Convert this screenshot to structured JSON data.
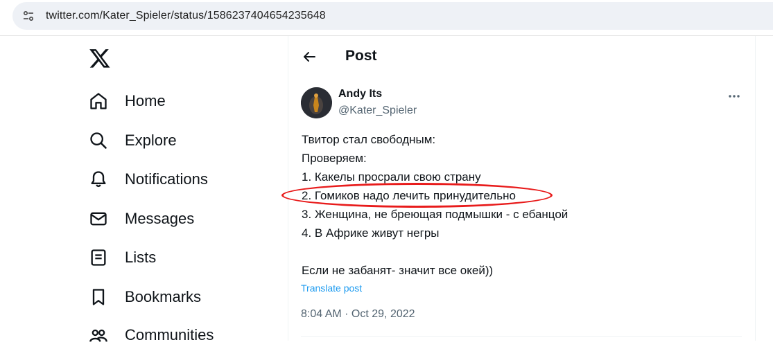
{
  "browser": {
    "url": "twitter.com/Kater_Spieler/status/1586237404654235648",
    "site_info_icon": "tune-icon"
  },
  "nav": {
    "logo_icon": "x-logo-icon",
    "items": [
      {
        "label": "Home",
        "icon": "home-icon"
      },
      {
        "label": "Explore",
        "icon": "search-icon"
      },
      {
        "label": "Notifications",
        "icon": "bell-icon"
      },
      {
        "label": "Messages",
        "icon": "mail-icon"
      },
      {
        "label": "Lists",
        "icon": "list-icon"
      },
      {
        "label": "Bookmarks",
        "icon": "bookmark-icon"
      },
      {
        "label": "Communities",
        "icon": "communities-icon"
      }
    ]
  },
  "header": {
    "title": "Post",
    "back_icon": "back-arrow-icon"
  },
  "post": {
    "author_name": "Andy Its",
    "author_handle": "@Kater_Spieler",
    "lines": [
      "Твитор стал свободным:",
      "Проверяем:",
      "1. Какелы просрали свою страну",
      "2. Гомиков надо лечить принудительно",
      "3. Женщина, не бреющая подмышки - с ебанцой",
      "4. В Африке живут негры",
      "",
      "Если не забанят- значит все окей))"
    ],
    "translate_label": "Translate post",
    "timestamp": "8:04 AM · Oct 29, 2022"
  },
  "annotation": {
    "color": "#e81b1b",
    "highlighted_line": 3
  },
  "colors": {
    "accent": "#1d9bf0",
    "secondary_text": "#536471",
    "primary_text": "#0f1419"
  }
}
